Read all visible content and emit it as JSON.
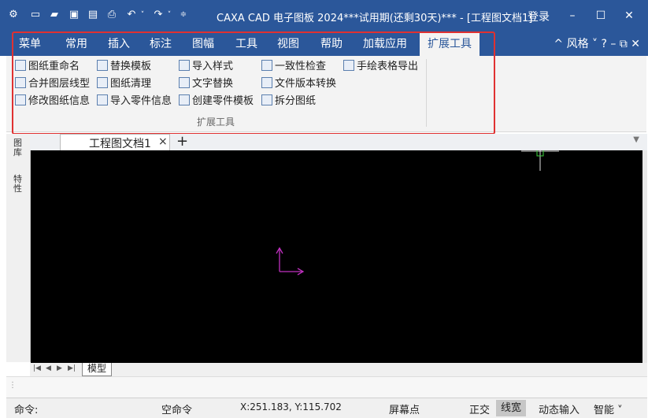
{
  "title": "CAXA CAD 电子图板 2024***试用期(还剩30天)*** - [工程图文档1]",
  "login": "登录",
  "window_controls": [
    "–",
    "☐",
    "✕"
  ],
  "quick_access": [
    "app-logo-icon",
    "new-file-icon",
    "open-folder-icon",
    "save-icon",
    "save-as-icon",
    "print-icon",
    "undo-icon",
    "dropdown-icon",
    "redo-icon",
    "dropdown-icon",
    "customize-icon"
  ],
  "menu_tabs": [
    "菜单",
    "常用",
    "插入",
    "标注",
    "图幅",
    "工具",
    "视图",
    "帮助",
    "加载应用",
    "扩展工具"
  ],
  "active_tab": "扩展工具",
  "tabbar_right": "^ 风格 ˅ ? – ⧉ ✕",
  "ribbon": {
    "col1": [
      "图纸重命名",
      "合并图层线型",
      "修改图纸信息"
    ],
    "col2": [
      "替换模板",
      "图纸清理",
      "导入零件信息"
    ],
    "col3": [
      "导入样式",
      "文字替换",
      "创建零件模板"
    ],
    "col4": [
      "一致性检查",
      "文件版本转换",
      "拆分图纸"
    ],
    "col5": [
      "手绘表格导出"
    ],
    "group_label": "扩展工具"
  },
  "left_panel": [
    "图库",
    "特性"
  ],
  "doc_tab": {
    "label": "工程图文档1",
    "close": "×",
    "add": "+"
  },
  "model_tab": "模型",
  "status": {
    "command": "命令:",
    "empty_command": "空命令",
    "coords": "X:251.183, Y:115.702",
    "point_mode": "屏幕点",
    "ortho": "正交",
    "linewidth": "线宽",
    "dynamic_input": "动态输入",
    "smart": "智能 ˅"
  },
  "colors": {
    "title_bar": "#2b579a",
    "canvas": "#000000",
    "ucs_axis": "#c030c0",
    "cursor": "#3cd23c",
    "highlight_box": "#e03131"
  }
}
